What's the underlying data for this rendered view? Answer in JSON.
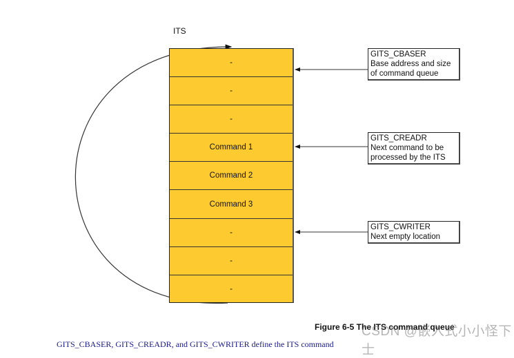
{
  "diagram": {
    "title": "ITS",
    "queue_slots": [
      "-",
      "-",
      "-",
      "Command 1",
      "Command 2",
      "Command 3",
      "-",
      "-",
      "-"
    ],
    "registers": [
      {
        "name": "GITS_CBASER",
        "description": "Base address and size of command queue",
        "points_to_slot": 0
      },
      {
        "name": "GITS_CREADR",
        "description": "Next command to be processed by the ITS",
        "points_to_slot": 3
      },
      {
        "name": "GITS_CWRITER",
        "description": "Next empty location",
        "points_to_slot": 6
      }
    ],
    "colors": {
      "slot_fill": "#fdca2f",
      "line": "#222222"
    },
    "caption": "Figure 6-5 The ITS command queue"
  },
  "body_text": "GITS_CBASER, GITS_CREADR, and GITS_CWRITER define the ITS command",
  "watermark": "CSDN @嵌入式小小怪下士"
}
